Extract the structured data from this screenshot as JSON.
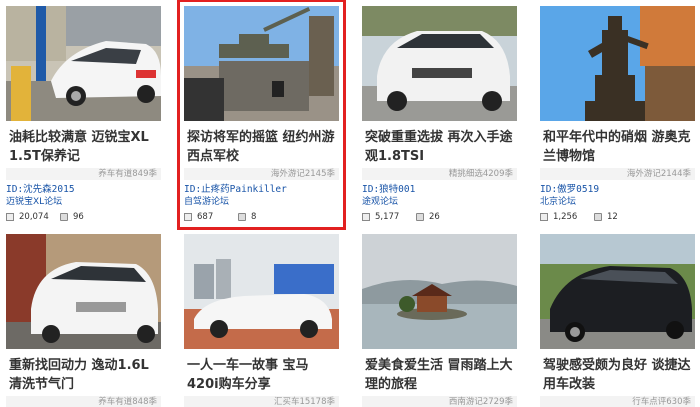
{
  "cards": [
    {
      "title": "油耗比较满意 迈锐宝XL 1.5T保养记",
      "tag": "养车有道849季",
      "user": "ID:沈先森2015",
      "forum": "迈锐宝XL论坛",
      "views": "20,074",
      "comments": "96",
      "thumb_icon": "white-sedan-garage-photo"
    },
    {
      "title": "探访将军的摇篮 纽约州游西点军校",
      "tag": "海外游记2145季",
      "user": "ID:止疼药Painkiller",
      "forum": "自驾游论坛",
      "views": "687",
      "comments": "8",
      "thumb_icon": "tank-monument-photo"
    },
    {
      "title": "突破重重选拔 再次入手途观1.8TSI",
      "tag": "精挑细选4209季",
      "user": "ID:狼特001",
      "forum": "途观论坛",
      "views": "5,177",
      "comments": "26",
      "thumb_icon": "white-suv-photo"
    },
    {
      "title": "和平年代中的硝烟 游奥克兰博物馆",
      "tag": "海外游记2144季",
      "user": "ID:傲罗0519",
      "forum": "北京论坛",
      "views": "1,256",
      "comments": "12",
      "thumb_icon": "statue-photo"
    },
    {
      "title": "重新找回动力 逸动1.6L清洗节气门",
      "tag": "养车有道848季",
      "thumb_icon": "white-sedan-workshop-photo"
    },
    {
      "title": "一人一车一故事 宝马420i购车分享",
      "tag": "汇买车15178季",
      "thumb_icon": "white-convertible-photo"
    },
    {
      "title": "爱美食爱生活 冒雨踏上大理的旅程",
      "tag": "西南游记2729季",
      "thumb_icon": "lake-pavilion-photo"
    },
    {
      "title": "驾驶感受颇为良好 谈捷达用车改装",
      "tag": "行车点评630季",
      "thumb_icon": "black-sedan-photo"
    }
  ]
}
